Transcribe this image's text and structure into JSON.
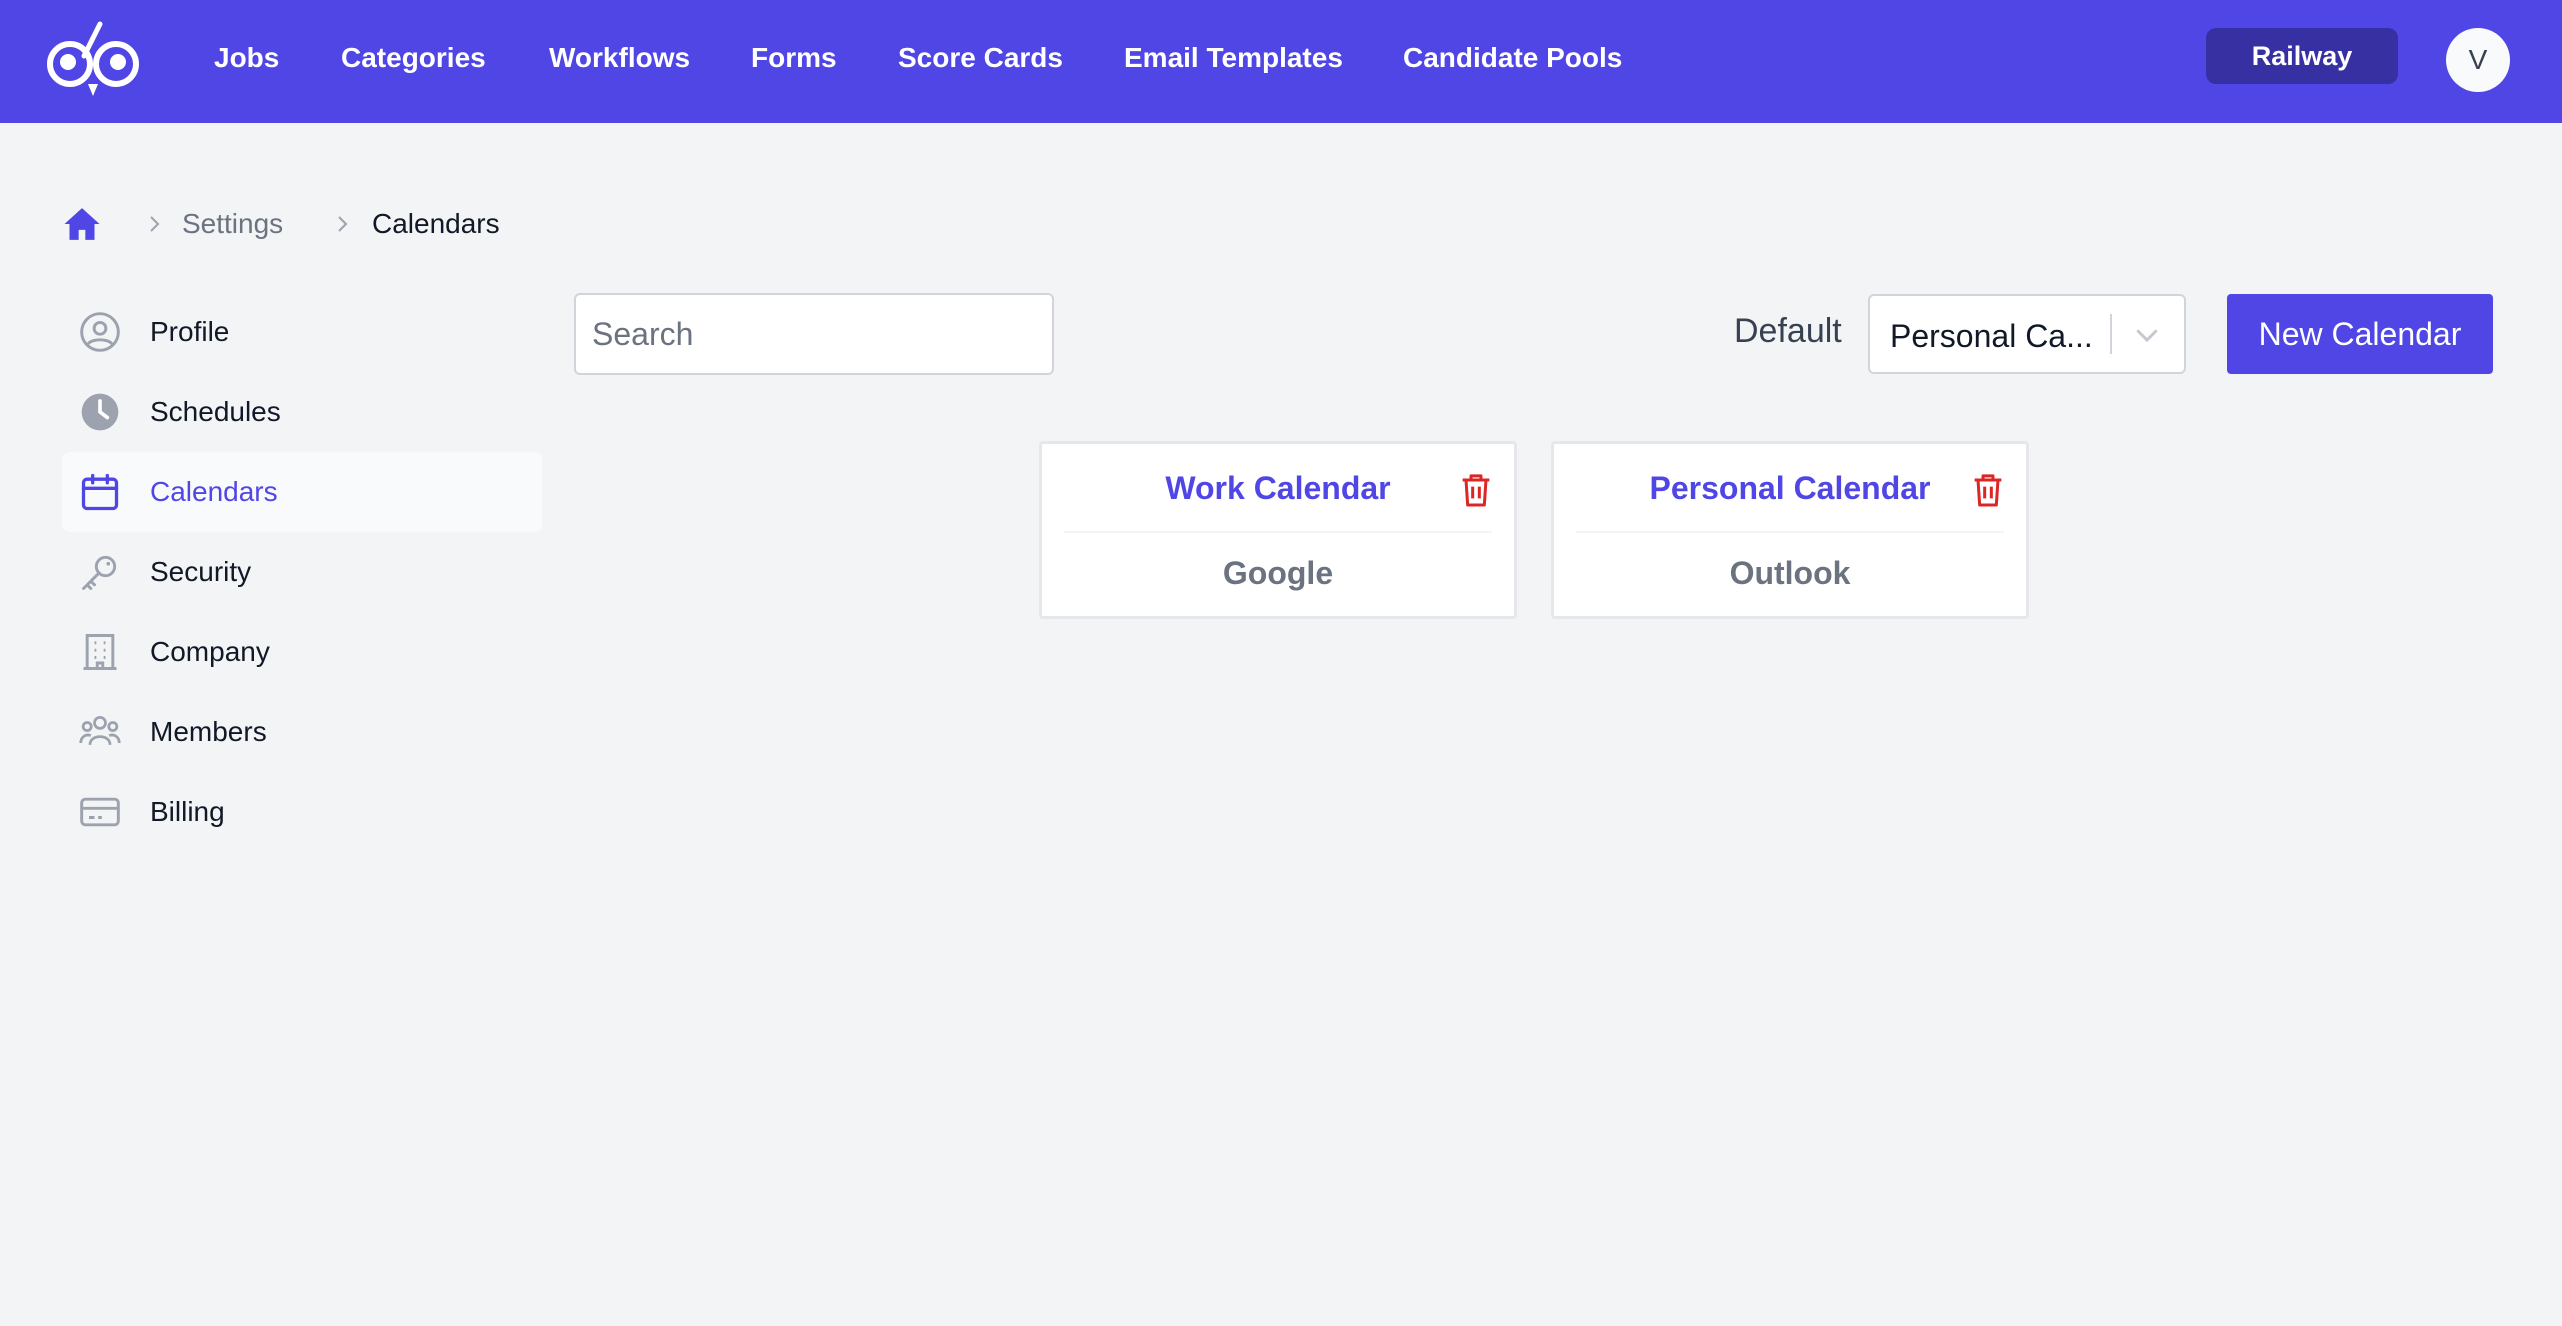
{
  "topnav": {
    "items": [
      "Jobs",
      "Categories",
      "Workflows",
      "Forms",
      "Score Cards",
      "Email Templates",
      "Candidate Pools"
    ],
    "org_button": "Railway",
    "avatar_initial": "V"
  },
  "breadcrumb": {
    "items": [
      "Settings",
      "Calendars"
    ]
  },
  "sidebar": {
    "items": [
      {
        "label": "Profile",
        "icon": "user-circle-icon"
      },
      {
        "label": "Schedules",
        "icon": "clock-icon"
      },
      {
        "label": "Calendars",
        "icon": "calendar-icon",
        "active": true
      },
      {
        "label": "Security",
        "icon": "key-icon"
      },
      {
        "label": "Company",
        "icon": "building-icon"
      },
      {
        "label": "Members",
        "icon": "users-icon"
      },
      {
        "label": "Billing",
        "icon": "credit-card-icon"
      }
    ]
  },
  "toolbar": {
    "search_placeholder": "Search",
    "default_label": "Default",
    "default_value": "Personal Ca...",
    "new_button": "New Calendar"
  },
  "calendars": [
    {
      "name": "Work Calendar",
      "provider": "Google"
    },
    {
      "name": "Personal Calendar",
      "provider": "Outlook"
    }
  ],
  "colors": {
    "brand": "#4f46e5",
    "brand_dark": "#3730a3",
    "danger": "#dc2626",
    "background": "#f3f4f6"
  }
}
